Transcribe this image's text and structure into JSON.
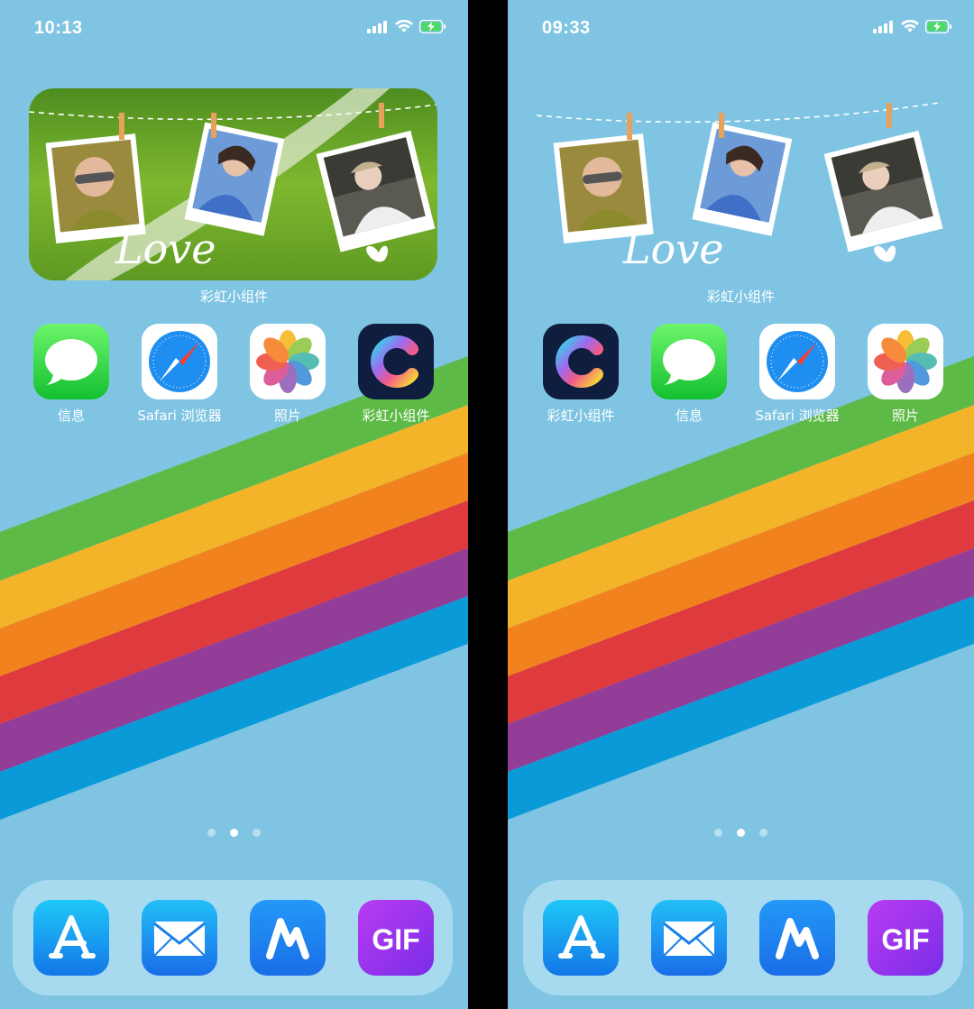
{
  "screens": [
    {
      "time": "10:13",
      "widget_label": "彩虹小组件",
      "apps": [
        {
          "label": "信息",
          "icon": "messages-icon"
        },
        {
          "label": "Safari 浏览器",
          "icon": "safari-icon"
        },
        {
          "label": "照片",
          "icon": "photos-icon"
        },
        {
          "label": "彩虹小组件",
          "icon": "rainbow-widget-icon"
        }
      ],
      "widget_text": "Love",
      "page_dots": 3,
      "active_dot": 2
    },
    {
      "time": "09:33",
      "widget_label": "彩虹小组件",
      "apps": [
        {
          "label": "彩虹小组件",
          "icon": "rainbow-widget-icon"
        },
        {
          "label": "信息",
          "icon": "messages-icon"
        },
        {
          "label": "Safari 浏览器",
          "icon": "safari-icon"
        },
        {
          "label": "照片",
          "icon": "photos-icon"
        }
      ],
      "widget_text": "Love",
      "page_dots": 3,
      "active_dot": 2
    }
  ],
  "dock": [
    {
      "label": "",
      "icon": "app-store-icon"
    },
    {
      "label": "",
      "icon": "mail-icon"
    },
    {
      "label": "",
      "icon": "maker-m-icon"
    },
    {
      "label": "GIF",
      "icon": "gif-icon"
    }
  ],
  "colors": {
    "wallpaper": "#7fc5e3",
    "rainbow": [
      "#5dba47",
      "#f3b42a",
      "#f2821e",
      "#df3a3e",
      "#923e98",
      "#0a9ad8"
    ]
  }
}
